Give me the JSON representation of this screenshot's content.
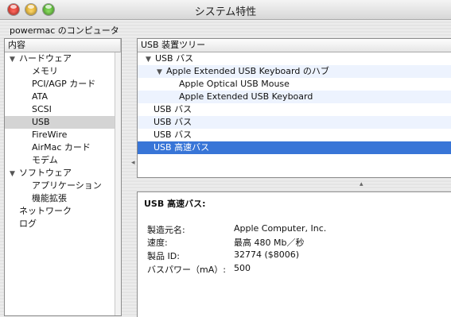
{
  "window": {
    "title": "システム特性"
  },
  "computer_name": "powermac のコンピュータ",
  "left_pane": {
    "header": "内容",
    "items": [
      {
        "label": "ハードウェア",
        "level": 0,
        "expanded": true,
        "selected": false
      },
      {
        "label": "メモリ",
        "level": 1,
        "selected": false
      },
      {
        "label": "PCI/AGP カード",
        "level": 1,
        "selected": false
      },
      {
        "label": "ATA",
        "level": 1,
        "selected": false
      },
      {
        "label": "SCSI",
        "level": 1,
        "selected": false
      },
      {
        "label": "USB",
        "level": 1,
        "selected": true
      },
      {
        "label": "FireWire",
        "level": 1,
        "selected": false
      },
      {
        "label": "AirMac カード",
        "level": 1,
        "selected": false
      },
      {
        "label": "モデム",
        "level": 1,
        "selected": false
      },
      {
        "label": "ソフトウェア",
        "level": 0,
        "expanded": true,
        "selected": false
      },
      {
        "label": "アプリケーション",
        "level": 1,
        "selected": false
      },
      {
        "label": "機能拡張",
        "level": 1,
        "selected": false
      },
      {
        "label": "ネットワーク",
        "level": 0,
        "selected": false
      },
      {
        "label": "ログ",
        "level": 0,
        "selected": false
      }
    ]
  },
  "usb_tree": {
    "header": "USB 装置ツリー",
    "rows": [
      {
        "label": "USB バス",
        "level": 0,
        "expanded": true,
        "selected": false
      },
      {
        "label": "Apple Extended USB Keyboard のハブ",
        "level": 1,
        "expanded": true,
        "selected": false
      },
      {
        "label": "Apple Optical USB Mouse",
        "level": 2,
        "selected": false
      },
      {
        "label": "Apple Extended USB Keyboard",
        "level": 2,
        "selected": false
      },
      {
        "label": "USB バス",
        "level": 0,
        "selected": false
      },
      {
        "label": "USB バス",
        "level": 0,
        "selected": false
      },
      {
        "label": "USB バス",
        "level": 0,
        "selected": false
      },
      {
        "label": "USB 高速バス",
        "level": 0,
        "selected": true
      }
    ]
  },
  "detail": {
    "title": "USB 高速バス:",
    "fields": [
      {
        "label": "製造元名:",
        "value": "Apple Computer, Inc."
      },
      {
        "label": "速度:",
        "value": "最高 480 Mb／秒"
      },
      {
        "label": "製品 ID:",
        "value": "32774 ($8006)"
      },
      {
        "label": "バスパワー（mA）:",
        "value": "500"
      }
    ]
  },
  "colors": {
    "selection_blue": "#3875d7",
    "row_stripe": "#edf3fe",
    "sidebar_selection": "#d4d4d4"
  }
}
